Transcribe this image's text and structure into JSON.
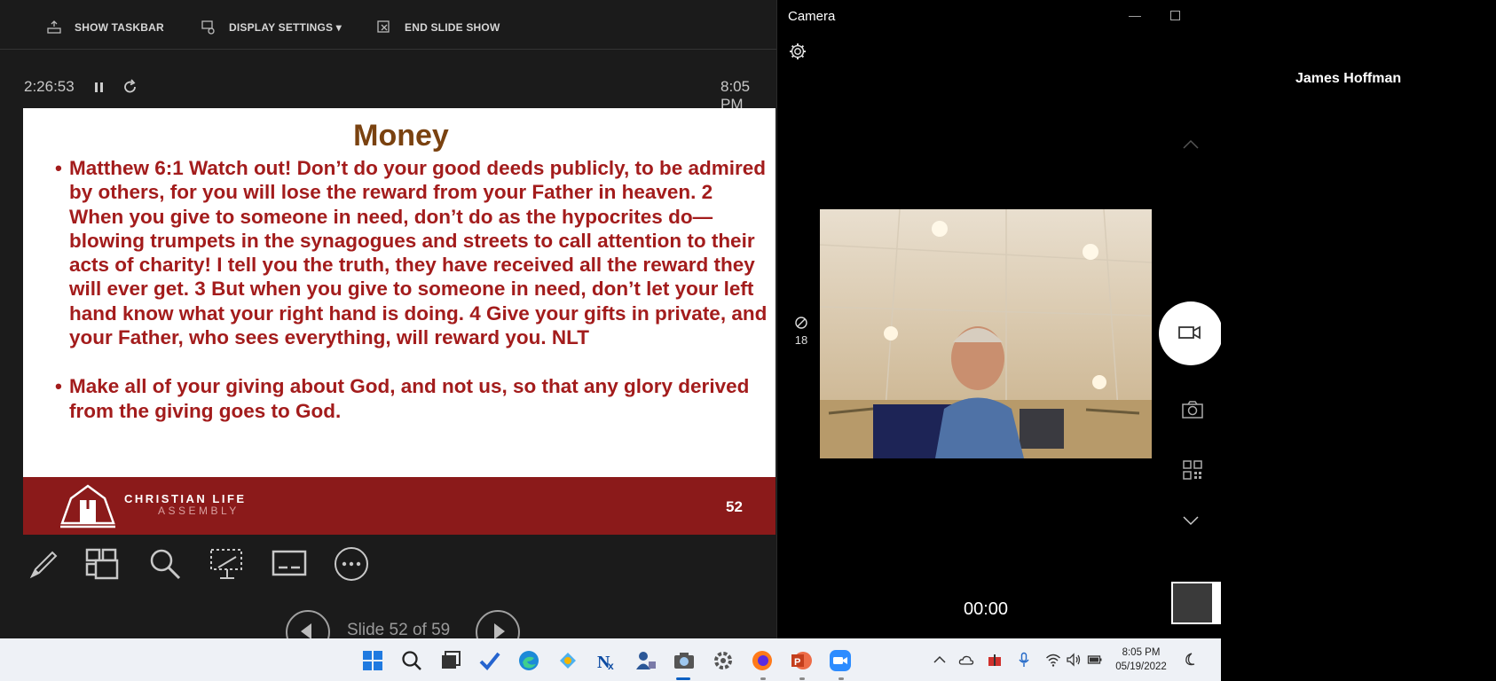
{
  "presenter": {
    "toolbar": {
      "show_taskbar": "SHOW TASKBAR",
      "display_settings": "DISPLAY SETTINGS ▾",
      "end_slide_show": "END SLIDE SHOW"
    },
    "elapsed_timer": "2:26:53",
    "clock": "8:05 PM",
    "slide": {
      "title": "Money",
      "bullets": [
        "Matthew 6:1 Watch out! Don’t do your good deeds publicly, to be admired by others, for you will lose the reward from your Father in heaven. 2 When you give to someone in need, don’t do as the hypocrites do—blowing trumpets in the synagogues and streets to call attention to their acts of charity! I tell you the truth, they have received all the reward they will ever get. 3 But when you give to someone in need, don’t let your left hand know what your right hand is doing. 4 Give your gifts in private, and your Father, who sees everything, will reward you. NLT",
        "Make all of your giving about God, and not us, so that any glory derived from the giving goes to God."
      ],
      "logo_line1": "CHRISTIAN LIFE",
      "logo_line2": "ASSEMBLY",
      "number": "52"
    },
    "slide_counter": "Slide 52 of 59"
  },
  "camera": {
    "title": "Camera",
    "timer_seconds": "18",
    "recording_time": "00:00"
  },
  "participant_name": "James Hoffman",
  "taskbar": {
    "time": "8:05 PM",
    "date": "05/19/2022"
  },
  "colors": {
    "slide_text": "#a31c1c",
    "slide_title": "#7a4210",
    "slide_footer": "#8b1a1a",
    "presenter_bg": "#1b1b1b",
    "taskbar_bg": "#eef1f6"
  }
}
